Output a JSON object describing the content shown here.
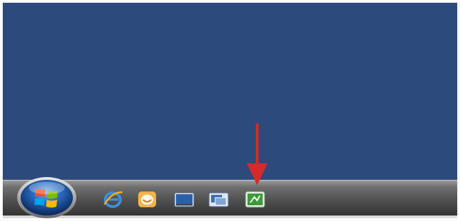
{
  "desktop": {
    "background_color": "#2d4a7c"
  },
  "taskbar": {
    "start_button": {
      "icon": "windows-logo-icon"
    },
    "quick_launch": [
      {
        "icon": "internet-explorer-icon"
      },
      {
        "icon": "windows-mail-icon"
      },
      {
        "icon": "show-desktop-icon"
      },
      {
        "icon": "switch-windows-icon"
      },
      {
        "icon": "green-app-icon"
      }
    ]
  },
  "annotation": {
    "arrow_color": "#d42a2a",
    "points_to": "green-app-icon"
  }
}
